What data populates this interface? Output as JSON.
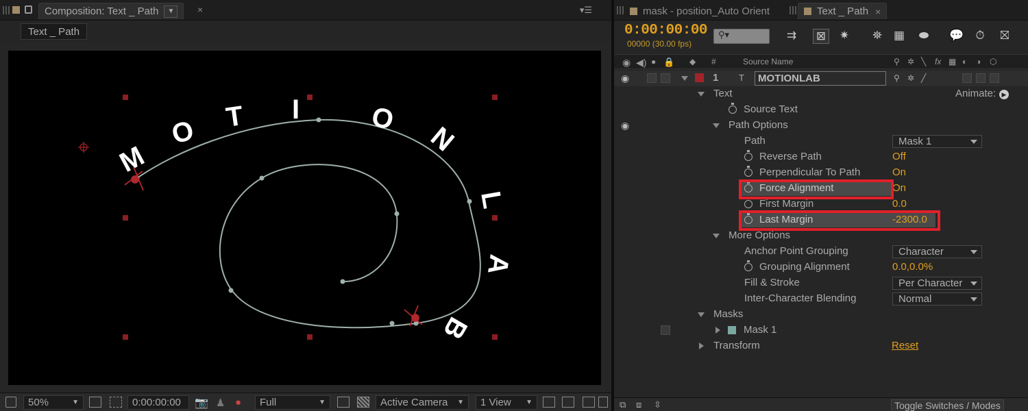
{
  "comp_panel": {
    "tab_title": "Composition: Text _ Path",
    "comp_name_chip": "Text _ Path",
    "menu_icon": "panel-menu-icon",
    "viewer_text": [
      "M",
      "O",
      "T",
      "I",
      "O",
      "N",
      "L",
      "A",
      "B"
    ],
    "bottom": {
      "zoom": "50%",
      "timecode": "0:00:00:00",
      "resolution": "Full",
      "view": "Active Camera",
      "views_count": "1 View"
    }
  },
  "timeline": {
    "tabs": [
      {
        "label": "mask - position_Auto Orient",
        "active": false
      },
      {
        "label": "Text _ Path",
        "active": true
      }
    ],
    "timecode": "0:00:00:00",
    "fps": "00000 (30.00 fps)",
    "search_placeholder": "",
    "column_headers": {
      "hash": "#",
      "source_name": "Source Name",
      "fx": "fx"
    },
    "layer": {
      "number": "1",
      "name": "MOTIONLAB"
    },
    "rows": {
      "text": "Text",
      "animate": "Animate:",
      "source_text": "Source Text",
      "path_options": "Path Options",
      "path": "Path",
      "path_value": "Mask 1",
      "reverse_path": "Reverse Path",
      "reverse_path_value": "Off",
      "perpendicular": "Perpendicular To Path",
      "perpendicular_value": "On",
      "force_alignment": "Force Alignment",
      "force_alignment_value": "On",
      "first_margin": "First Margin",
      "first_margin_value": "0.0",
      "last_margin": "Last Margin",
      "last_margin_value": "-2300.0",
      "more_options": "More Options",
      "anchor_grouping": "Anchor Point Grouping",
      "anchor_grouping_value": "Character",
      "grouping_alignment": "Grouping Alignment",
      "grouping_alignment_value": "0.0,0.0%",
      "fill_stroke": "Fill & Stroke",
      "fill_stroke_value": "Per Character",
      "inter_char": "Inter-Character Blending",
      "inter_char_value": "Normal",
      "masks": "Masks",
      "mask1": "Mask 1",
      "transform": "Transform",
      "reset": "Reset"
    },
    "bottom": {
      "toggle": "Toggle Switches / Modes"
    }
  },
  "colors": {
    "accent": "#e0a020",
    "highlight": "#e0202a",
    "layer_label": "#a0242a",
    "mask_color": "#7aa8a0"
  }
}
